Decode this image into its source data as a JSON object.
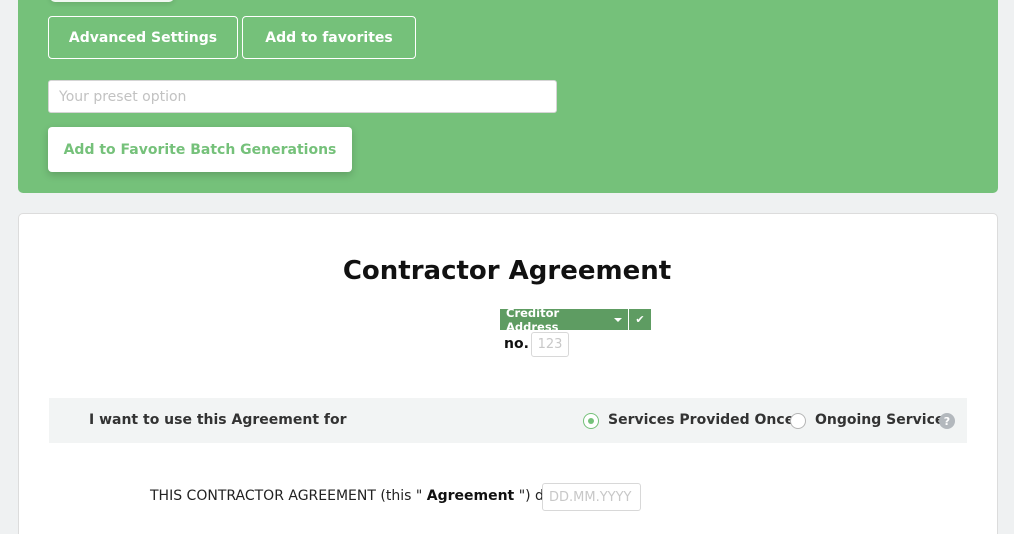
{
  "toolbar": {
    "advanced_settings_label": "Advanced Settings",
    "add_to_favorites_label": "Add to favorites",
    "preset_placeholder": "Your preset option",
    "preset_value": "",
    "batch_button_label": "Add to Favorite Batch Generations"
  },
  "document": {
    "title": "Contractor Agreement",
    "creditor_tag_label": "Creditor Address",
    "no_label": "no.",
    "no_placeholder": "123",
    "usage": {
      "question": "I want to use this Agreement for",
      "options": [
        {
          "label": "Services Provided Once",
          "selected": true
        },
        {
          "label": "Ongoing Services",
          "selected": false
        }
      ],
      "help_glyph": "?"
    },
    "clause": {
      "prefix": "THIS CONTRACTOR AGREEMENT (this \"",
      "bold": "Agreement",
      "suffix": "\") dated",
      "date_placeholder": "DD.MM.YYYY"
    }
  },
  "colors": {
    "accent_green": "#75c17a",
    "tag_green": "#5e9c62",
    "background": "#eff1f2"
  },
  "icons": {
    "creditor_dropdown": "chevron-down-icon",
    "creditor_confirm": "check-icon",
    "help": "help-icon"
  }
}
